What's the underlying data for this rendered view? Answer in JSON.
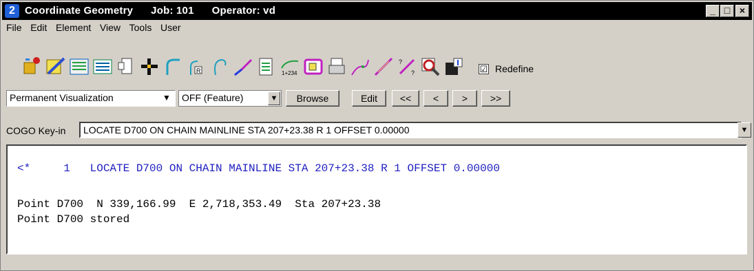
{
  "window": {
    "title": "Coordinate Geometry",
    "job": "Job: 101",
    "operator": "Operator: vd",
    "logo": "2"
  },
  "menu": [
    "File",
    "Edit",
    "Element",
    "View",
    "Tools",
    "User"
  ],
  "toolbar": {
    "icons": [
      "store-point-icon",
      "edit-point-icon",
      "list-icon",
      "table-icon",
      "copy-icon",
      "crosshair-icon",
      "curve-icon",
      "radius-icon",
      "spiral-icon",
      "chain-icon",
      "document-icon",
      "station-icon",
      "parcel-icon",
      "print-icon",
      "alignment-icon",
      "measure-icon",
      "transform-icon",
      "zoom-icon",
      "import-icon"
    ],
    "redefine_label": "Redefine",
    "redefine_checked": "☑"
  },
  "controls": {
    "visualization": "Permanent Visualization",
    "feature": "OFF (Feature)",
    "browse": "Browse",
    "edit": "Edit",
    "first": "<<",
    "prev": "<",
    "next": ">",
    "last": ">>"
  },
  "keyin": {
    "label": "COGO Key-in",
    "value": "LOCATE D700 ON CHAIN MAINLINE STA 207+23.38 R 1 OFFSET 0.00000"
  },
  "output": {
    "command_line": "<*     1   LOCATE D700 ON CHAIN MAINLINE STA 207+23.38 R 1 OFFSET 0.00000",
    "result_line": "Point D700  N 339,166.99  E 2,718,353.49  Sta 207+23.38",
    "stored_line": "Point D700 stored"
  }
}
